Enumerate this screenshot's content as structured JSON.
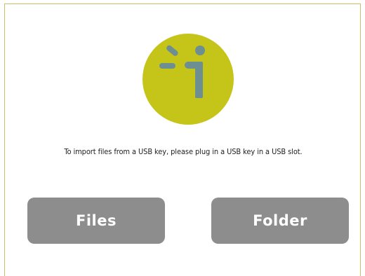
{
  "dialog": {
    "message": "To import files from a USB key, please plug in a USB key in a USB slot.",
    "buttons": {
      "files_label": "Files",
      "folder_label": "Folder"
    }
  },
  "logo": {
    "icon": "info-icon",
    "circle_color": "#c4c419",
    "glyph_color": "#6e8f92"
  },
  "colors": {
    "button_bg": "#8d8d8d",
    "button_text": "#ffffff",
    "border": "#c9c26a"
  }
}
